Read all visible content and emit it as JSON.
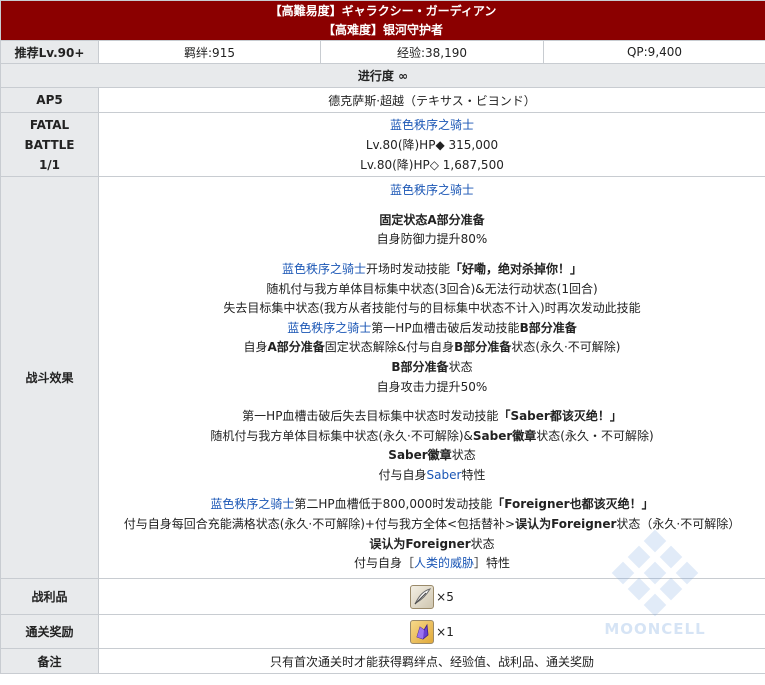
{
  "header": {
    "title_jp": "【高難易度】ギャラクシー・ガーディアン",
    "title_cn": "【高难度】银河守护者"
  },
  "stats": {
    "level": "推荐Lv.90+",
    "bond": "羁绊:915",
    "exp": "经验:38,190",
    "qp": "QP:9,400"
  },
  "progress": "进行度 ∞",
  "ap": {
    "label": "AP5",
    "location": "德克萨斯·超越（テキサス・ビヨンド）"
  },
  "battle": {
    "label_line1": "FATAL",
    "label_line2": "BATTLE",
    "label_line3": "1/1",
    "enemy_name": "蓝色秩序之骑士",
    "hp1": "Lv.80(降)HP◆ 315,000",
    "hp2": "Lv.80(降)HP◇ 1,687,500"
  },
  "effects": {
    "label": "战斗效果",
    "b1_name": "蓝色秩序之骑士",
    "b1_l1": "固定状态A部分准备",
    "b1_l2": "自身防御力提升80%",
    "b2_name": "蓝色秩序之骑士",
    "b2_l1_a": "开场时发动技能",
    "b2_l1_b": "「好嘞，绝对杀掉你！」",
    "b2_l2": "随机付与我方单体目标集中状态(3回合)&无法行动状态(1回合)",
    "b2_l3": "失去目标集中状态(我方从者技能付与的目标集中状态不计入)时再次发动此技能",
    "b3_name": "蓝色秩序之骑士",
    "b3_l1_a": "第一HP血槽击破后发动技能",
    "b3_l1_b": "B部分准备",
    "b3_l2_a": "自身",
    "b3_l2_b": "A部分准备",
    "b3_l2_c": "固定状态解除&付与自身",
    "b3_l2_d": "B部分准备",
    "b3_l2_e": "状态(永久·不可解除)",
    "b3_l3_a": "B部分准备",
    "b3_l3_b": "状态",
    "b3_l4": "自身攻击力提升50%",
    "b4_l1_a": "第一HP血槽击破后失去目标集中状态时发动技能",
    "b4_l1_b": "「Saber都该灭绝！」",
    "b4_l2_a": "随机付与我方单体目标集中状态(永久·不可解除)&",
    "b4_l2_b": "Saber徽章",
    "b4_l2_c": "状态(永久・不可解除)",
    "b4_l3_a": "Saber徽章",
    "b4_l3_b": "状态",
    "b4_l4_a": "付与自身",
    "b4_l4_b": "Saber",
    "b4_l4_c": "特性",
    "b5_name": "蓝色秩序之骑士",
    "b5_l1_a": "第二HP血槽低于800,000时发动技能",
    "b5_l1_b": "「Foreigner也都该灭绝！」",
    "b5_l2_a": "付与自身每回合充能满格状态(永久·不可解除)+付与我方全体<包括替补>",
    "b5_l2_b": "误认为Foreigner",
    "b5_l2_c": "状态（永久·不可解除）",
    "b5_l3_a": "误认为Foreigner",
    "b5_l3_b": "状态",
    "b5_l4_a": "付与自身［",
    "b5_l4_b": "人类的威胁",
    "b5_l4_c": "］特性"
  },
  "drops": {
    "label": "战利品",
    "item_icon": "feather-quill-icon",
    "qty": "×5"
  },
  "reward": {
    "label": "通关奖励",
    "item_icon": "purple-crystal-icon",
    "qty": "×1"
  },
  "note": {
    "label": "备注",
    "text": "只有首次通关时才能获得羁绊点、经验值、战利品、通关奖励"
  },
  "watermark": "MOONCELL",
  "colors": {
    "header_bg": "#8b0000",
    "label_bg": "#e8eaec",
    "link_blue": "#1a56b5",
    "border": "#c8ccd1"
  }
}
